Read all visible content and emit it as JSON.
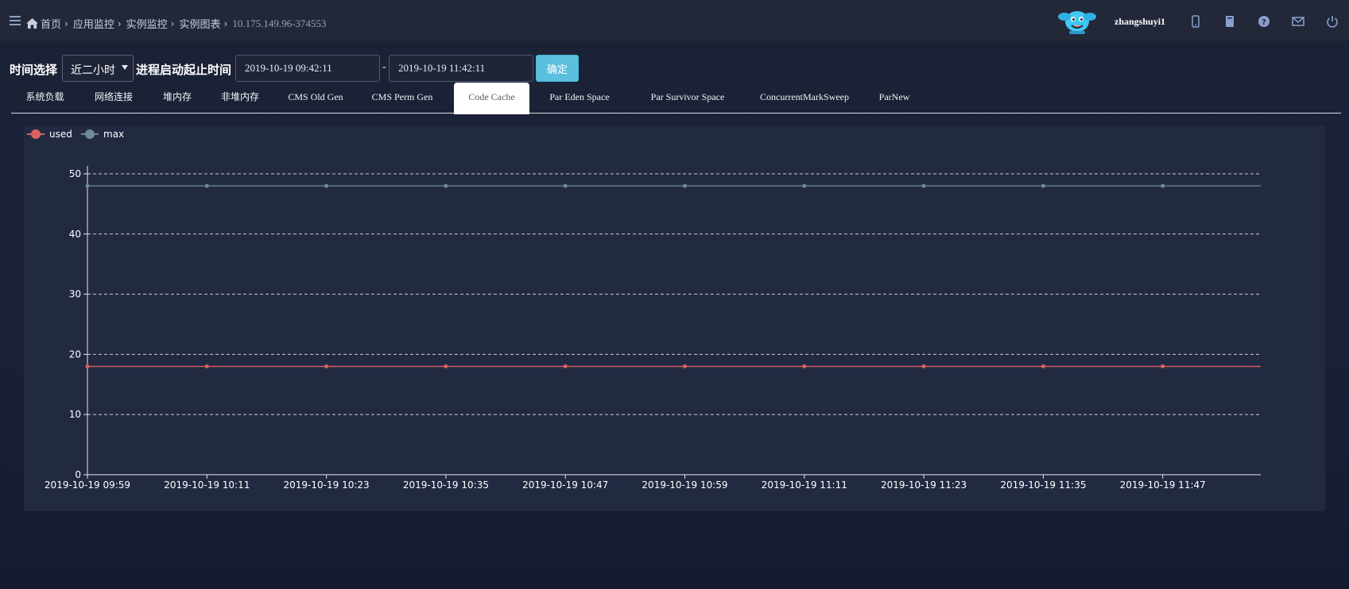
{
  "header": {
    "breadcrumbs": [
      "首页",
      "应用监控",
      "实例监控",
      "实例图表"
    ],
    "instance": "10.175.149.96-374553",
    "username": "zhangshuyi1",
    "icons": [
      "menu-icon",
      "home-icon",
      "mascot-logo",
      "mobile-icon",
      "book-icon",
      "help-icon",
      "mail-icon",
      "power-icon"
    ]
  },
  "toolbar": {
    "time_label": "时间选择",
    "time_range_selected": "近二小时",
    "range_label": "进程启动起止时间",
    "start_time": "2019-10-19 09:42:11",
    "separator": "-",
    "end_time": "2019-10-19 11:42:11",
    "confirm_label": "确定"
  },
  "tabs": [
    {
      "label": "系统负载",
      "active": false
    },
    {
      "label": "网络连接",
      "active": false
    },
    {
      "label": "堆内存",
      "active": false
    },
    {
      "label": "非堆内存",
      "active": false
    },
    {
      "label": "CMS Old Gen",
      "active": false
    },
    {
      "label": "CMS Perm Gen",
      "active": false
    },
    {
      "label": "Code Cache",
      "active": true
    },
    {
      "label": "Par Eden Space",
      "active": false
    },
    {
      "label": "Par Survivor Space",
      "active": false
    },
    {
      "label": "ConcurrentMarkSweep",
      "active": false
    },
    {
      "label": "ParNew",
      "active": false
    }
  ],
  "chart_data": {
    "type": "line",
    "x": [
      "2019-10-19 09:59",
      "2019-10-19 10:11",
      "2019-10-19 10:23",
      "2019-10-19 10:35",
      "2019-10-19 10:47",
      "2019-10-19 10:59",
      "2019-10-19 11:11",
      "2019-10-19 11:23",
      "2019-10-19 11:35",
      "2019-10-19 11:47"
    ],
    "series": [
      {
        "name": "used",
        "color": "#d9625f",
        "values": [
          18,
          18,
          18,
          18,
          18,
          18,
          18,
          18,
          18,
          18
        ]
      },
      {
        "name": "max",
        "color": "#6e8c96",
        "values": [
          48,
          48,
          48,
          48,
          48,
          48,
          48,
          48,
          48,
          48
        ]
      }
    ],
    "yticks": [
      "0",
      "10",
      "20",
      "30",
      "40",
      "50"
    ],
    "ylim": [
      0,
      50
    ],
    "grid": true,
    "legend_position": "top-left"
  }
}
